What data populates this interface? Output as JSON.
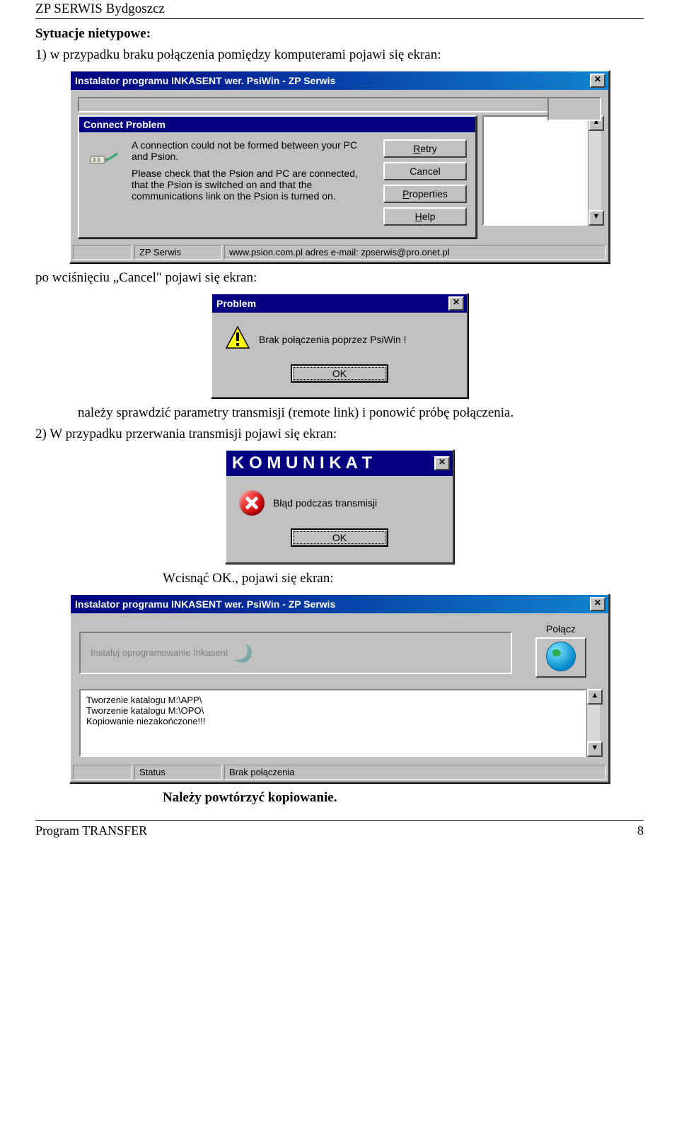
{
  "header": "ZP SERWIS Bydgoszcz",
  "section_title": "Sytuacje nietypowe:",
  "line1": "1) w przypadku braku połączenia pomiędzy komputerami pojawi się ekran:",
  "dialog1": {
    "title": "Instalator programu INKASENT wer. PsiWin  - ZP Serwis",
    "inner": {
      "title": "Connect Problem",
      "text1": "A connection could not be formed between your PC and Psion.",
      "text2": "Please check that the Psion and PC are connected, that the Psion is switched on and that the communications link on the Psion is turned on.",
      "buttons": {
        "retry_u": "R",
        "retry": "etry",
        "cancel": "Cancel",
        "prop_u": "P",
        "prop": "roperties",
        "help_u": "H",
        "help": "elp"
      }
    },
    "status": {
      "c1": "",
      "c2": "ZP Serwis",
      "c3": "www.psion.com.pl   adres e-mail: zpserwis@pro.onet.pl"
    }
  },
  "line2": "po wciśnięciu „Cancel\" pojawi się ekran:",
  "dialog2": {
    "title": "Problem",
    "msg": "Brak połączenia poprzez PsiWin !",
    "ok": "OK"
  },
  "line3": "należy sprawdzić parametry transmisji (remote link) i ponowić próbę połączenia.",
  "line4": "2) W przypadku przerwania transmisji pojawi się ekran:",
  "dialog3": {
    "title": "K O M U N I K A T",
    "msg": "Błąd podczas transmisji",
    "ok": "OK"
  },
  "line5": "Wcisnąć OK., pojawi się ekran:",
  "dialog4": {
    "title": "Instalator programu INKASENT wer. PsiWin  - ZP Serwis",
    "install_label": "Instaluj oprogramowanie Inkasent",
    "connect": "Połącz",
    "log1": "Tworzenie katalogu M:\\APP\\",
    "log2": "Tworzenie katalogu M:\\OPO\\",
    "log3": "Kopiowanie niezakończone!!!",
    "status_label": "Status",
    "status_value": "Brak połączenia"
  },
  "line6": "Należy powtórzyć kopiowanie.",
  "footer_left": "Program TRANSFER",
  "footer_right": "8"
}
